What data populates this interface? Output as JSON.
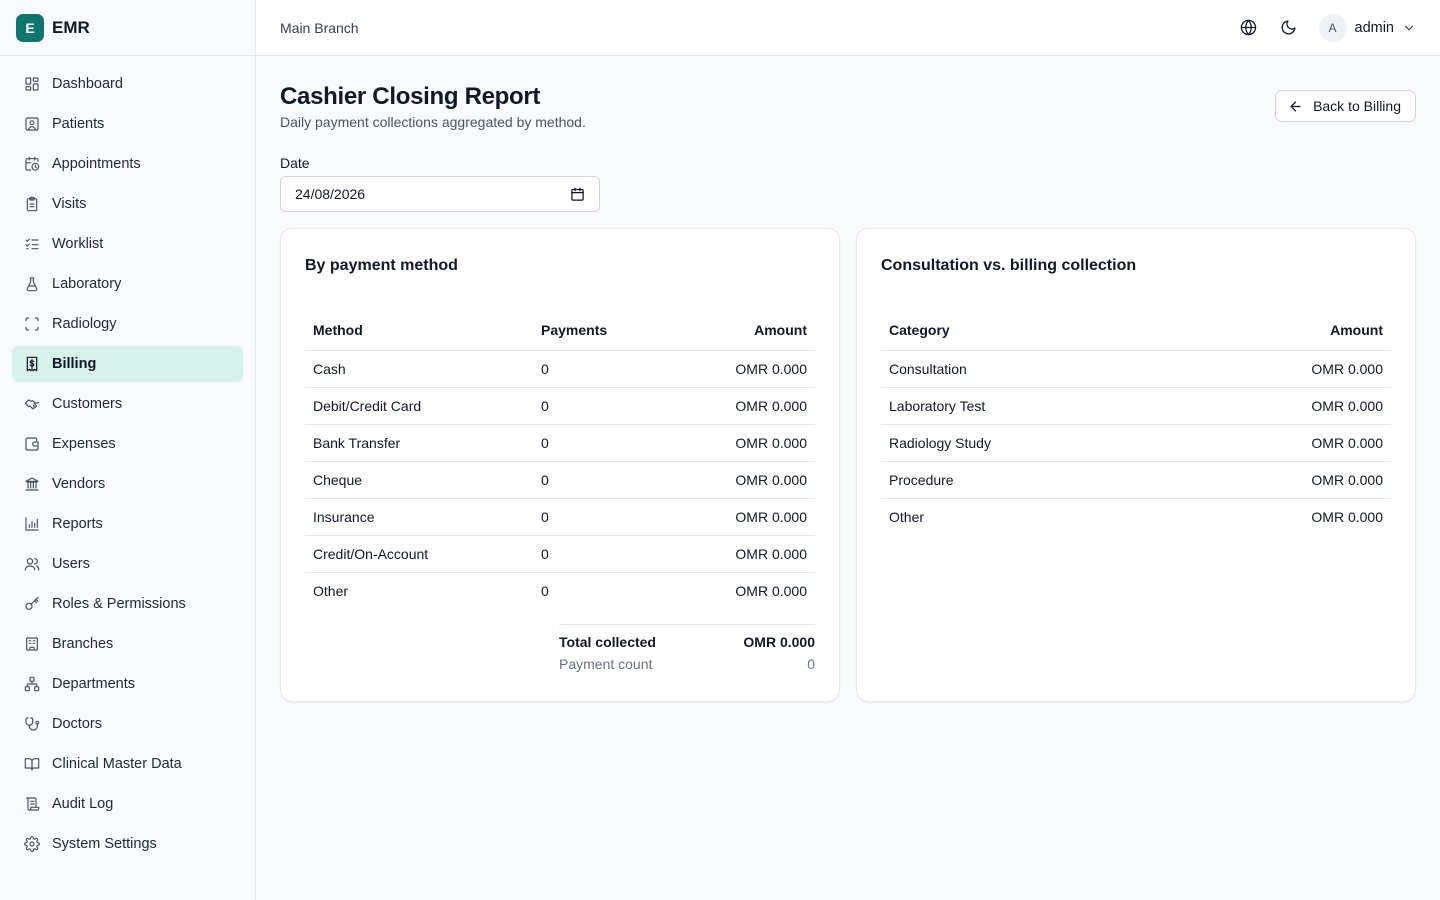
{
  "app": {
    "logo_letter": "E",
    "name": "EMR"
  },
  "sidebar": {
    "items": [
      {
        "label": "Dashboard",
        "icon": "dashboard-icon",
        "active": false
      },
      {
        "label": "Patients",
        "icon": "patients-icon",
        "active": false
      },
      {
        "label": "Appointments",
        "icon": "calendar-clock-icon",
        "active": false
      },
      {
        "label": "Visits",
        "icon": "clipboard-icon",
        "active": false
      },
      {
        "label": "Worklist",
        "icon": "checklist-icon",
        "active": false
      },
      {
        "label": "Laboratory",
        "icon": "flask-icon",
        "active": false
      },
      {
        "label": "Radiology",
        "icon": "scan-icon",
        "active": false
      },
      {
        "label": "Billing",
        "icon": "receipt-dollar-icon",
        "active": true
      },
      {
        "label": "Customers",
        "icon": "handshake-icon",
        "active": false
      },
      {
        "label": "Expenses",
        "icon": "wallet-icon",
        "active": false
      },
      {
        "label": "Vendors",
        "icon": "bank-icon",
        "active": false
      },
      {
        "label": "Reports",
        "icon": "bar-chart-icon",
        "active": false
      },
      {
        "label": "Users",
        "icon": "users-icon",
        "active": false
      },
      {
        "label": "Roles & Permissions",
        "icon": "key-icon",
        "active": false
      },
      {
        "label": "Branches",
        "icon": "building-icon",
        "active": false
      },
      {
        "label": "Departments",
        "icon": "network-icon",
        "active": false
      },
      {
        "label": "Doctors",
        "icon": "stethoscope-icon",
        "active": false
      },
      {
        "label": "Clinical Master Data",
        "icon": "book-icon",
        "active": false
      },
      {
        "label": "Audit Log",
        "icon": "scroll-icon",
        "active": false
      },
      {
        "label": "System Settings",
        "icon": "gear-icon",
        "active": false
      }
    ]
  },
  "header": {
    "branch": "Main Branch",
    "user_initial": "A",
    "user_name": "admin"
  },
  "page": {
    "title": "Cashier Closing Report",
    "subtitle": "Daily payment collections aggregated by method.",
    "back_label": "Back to Billing",
    "date_label": "Date",
    "date_value": "24/08/2026"
  },
  "by_method": {
    "title": "By payment method",
    "columns": [
      "Method",
      "Payments",
      "Amount"
    ],
    "rows": [
      {
        "method": "Cash",
        "payments": "0",
        "amount": "OMR 0.000"
      },
      {
        "method": "Debit/Credit Card",
        "payments": "0",
        "amount": "OMR 0.000"
      },
      {
        "method": "Bank Transfer",
        "payments": "0",
        "amount": "OMR 0.000"
      },
      {
        "method": "Cheque",
        "payments": "0",
        "amount": "OMR 0.000"
      },
      {
        "method": "Insurance",
        "payments": "0",
        "amount": "OMR 0.000"
      },
      {
        "method": "Credit/On-Account",
        "payments": "0",
        "amount": "OMR 0.000"
      },
      {
        "method": "Other",
        "payments": "0",
        "amount": "OMR 0.000"
      }
    ],
    "total_label": "Total collected",
    "total_value": "OMR 0.000",
    "count_label": "Payment count",
    "count_value": "0"
  },
  "by_category": {
    "title": "Consultation vs. billing collection",
    "columns": [
      "Category",
      "Amount"
    ],
    "rows": [
      {
        "category": "Consultation",
        "amount": "OMR 0.000"
      },
      {
        "category": "Laboratory Test",
        "amount": "OMR 0.000"
      },
      {
        "category": "Radiology Study",
        "amount": "OMR 0.000"
      },
      {
        "category": "Procedure",
        "amount": "OMR 0.000"
      },
      {
        "category": "Other",
        "amount": "OMR 0.000"
      }
    ]
  }
}
